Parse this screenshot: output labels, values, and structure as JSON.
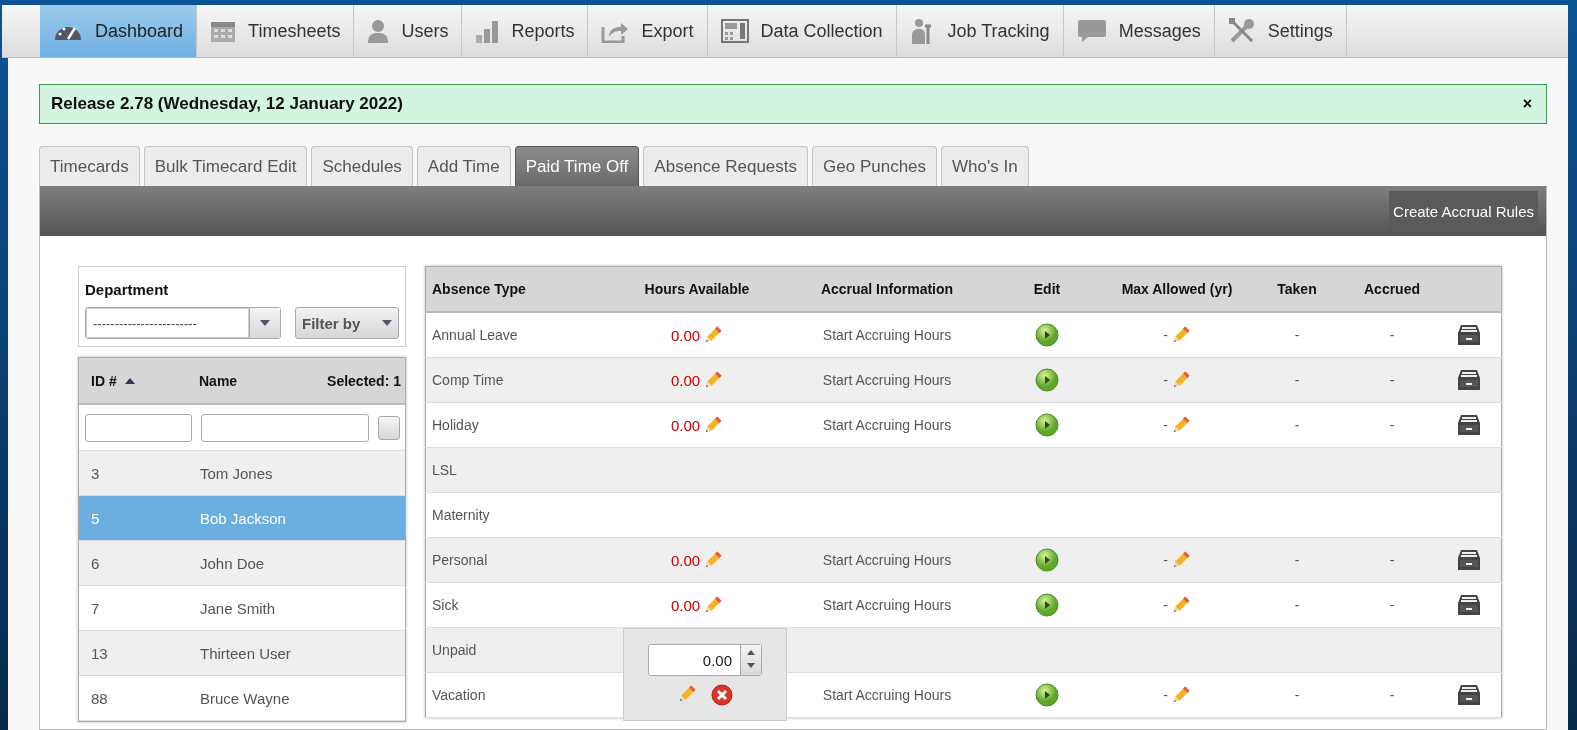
{
  "nav": [
    {
      "label": "Dashboard",
      "selected": true
    },
    {
      "label": "Timesheets",
      "selected": false
    },
    {
      "label": "Users",
      "selected": false
    },
    {
      "label": "Reports",
      "selected": false
    },
    {
      "label": "Export",
      "selected": false
    },
    {
      "label": "Data Collection",
      "selected": false
    },
    {
      "label": "Job Tracking",
      "selected": false
    },
    {
      "label": "Messages",
      "selected": false
    },
    {
      "label": "Settings",
      "selected": false
    }
  ],
  "banner": {
    "text": "Release 2.78 (Wednesday, 12 January 2022)",
    "close": "×"
  },
  "tabs": [
    {
      "label": "Timecards",
      "selected": false
    },
    {
      "label": "Bulk Timecard Edit",
      "selected": false
    },
    {
      "label": "Schedules",
      "selected": false
    },
    {
      "label": "Add Time",
      "selected": false
    },
    {
      "label": "Paid Time Off",
      "selected": true
    },
    {
      "label": "Absence Requests",
      "selected": false
    },
    {
      "label": "Geo Punches",
      "selected": false
    },
    {
      "label": "Who's In",
      "selected": false
    }
  ],
  "toolbar": {
    "button": "Create Accrual Rules"
  },
  "filter": {
    "label": "Department",
    "department": "------------------------",
    "filter_button": "Filter by"
  },
  "employees": {
    "columns": [
      "ID #",
      "Name"
    ],
    "selected_count": "Selected: 1",
    "rows": [
      {
        "id": "3",
        "name": "Tom Jones",
        "selected": false
      },
      {
        "id": "5",
        "name": "Bob Jackson",
        "selected": true
      },
      {
        "id": "6",
        "name": "John Doe",
        "selected": false
      },
      {
        "id": "7",
        "name": "Jane Smith",
        "selected": false
      },
      {
        "id": "13",
        "name": "Thirteen User",
        "selected": false
      },
      {
        "id": "88",
        "name": "Bruce Wayne",
        "selected": false
      }
    ]
  },
  "absences": {
    "columns": [
      "Absence Type",
      "Hours Available",
      "Accrual Information",
      "Edit",
      "Max Allowed (yr)",
      "Taken",
      "Accrued"
    ],
    "rows": [
      {
        "kind": "accrual",
        "type": "Annual Leave",
        "hours": "0.00",
        "accrual": "Start Accruing Hours",
        "max": "-",
        "taken": "-",
        "accrued": "-"
      },
      {
        "kind": "accrual",
        "type": "Comp Time",
        "hours": "0.00",
        "accrual": "Start Accruing Hours",
        "max": "-",
        "taken": "-",
        "accrued": "-"
      },
      {
        "kind": "accrual",
        "type": "Holiday",
        "hours": "0.00",
        "accrual": "Start Accruing Hours",
        "max": "-",
        "taken": "-",
        "accrued": "-"
      },
      {
        "kind": "plain",
        "type": "LSL"
      },
      {
        "kind": "plain",
        "type": "Maternity"
      },
      {
        "kind": "accrual",
        "type": "Personal",
        "hours": "0.00",
        "accrual": "Start Accruing Hours",
        "max": "-",
        "taken": "-",
        "accrued": "-"
      },
      {
        "kind": "accrual",
        "type": "Sick",
        "hours": "0.00",
        "accrual": "Start Accruing Hours",
        "max": "-",
        "taken": "-",
        "accrued": "-"
      },
      {
        "kind": "plain",
        "type": "Unpaid"
      },
      {
        "kind": "accrual",
        "type": "Vacation",
        "accrual": "Start Accruing Hours",
        "max": "-",
        "taken": "-",
        "accrued": "-"
      }
    ]
  },
  "popup": {
    "value": "0.00"
  }
}
